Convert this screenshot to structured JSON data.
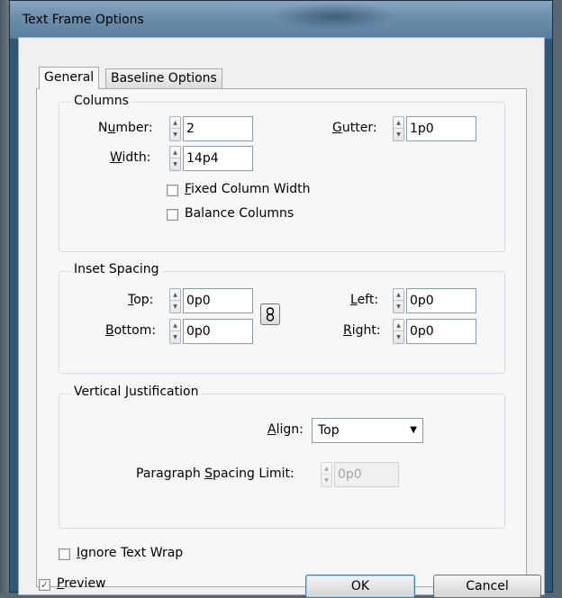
{
  "window": {
    "title": "Text Frame Options"
  },
  "tabs": [
    {
      "label": "General",
      "active": true
    },
    {
      "label": "Baseline Options",
      "active": false
    }
  ],
  "columns": {
    "group_label": "Columns",
    "number": {
      "label_pre": "N",
      "label_u": "u",
      "label_post": "mber:",
      "value": "2"
    },
    "gutter": {
      "label_pre": "",
      "label_u": "G",
      "label_post": "utter:",
      "value": "1p0"
    },
    "width": {
      "label_pre": "",
      "label_u": "W",
      "label_post": "idth:",
      "value": "14p4"
    },
    "fixed_column_width": {
      "label_pre": "",
      "label_u": "F",
      "label_post": "ixed Column Width",
      "checked": false
    },
    "balance_columns": {
      "label": "Balance Columns",
      "checked": false
    }
  },
  "inset_spacing": {
    "group_label": "Inset Spacing",
    "top": {
      "label_pre": "",
      "label_u": "T",
      "label_post": "op:",
      "value": "0p0"
    },
    "bottom": {
      "label_pre": "",
      "label_u": "B",
      "label_post": "ottom:",
      "value": "0p0"
    },
    "left": {
      "label_pre": "",
      "label_u": "L",
      "label_post": "eft:",
      "value": "0p0"
    },
    "right": {
      "label_pre": "",
      "label_u": "R",
      "label_post": "ight:",
      "value": "0p0"
    }
  },
  "vertical_justification": {
    "group_label": "Vertical Justification",
    "align": {
      "label_pre": "",
      "label_u": "A",
      "label_post": "lign:",
      "value": "Top"
    },
    "paragraph_spacing_limit": {
      "label_pre": "Paragraph ",
      "label_u": "S",
      "label_post": "pacing Limit:",
      "value": "0p0",
      "disabled": true
    }
  },
  "ignore_text_wrap": {
    "label_pre": "",
    "label_u": "I",
    "label_post": "gnore Text Wrap",
    "checked": false
  },
  "preview": {
    "label_pre": "",
    "label_u": "P",
    "label_post": "review",
    "checked": true
  },
  "buttons": {
    "ok": "OK",
    "cancel": "Cancel"
  },
  "icons": {
    "spinner_up": "▲",
    "spinner_down": "▼",
    "dropdown": "▼",
    "check": "✓",
    "link": "chain-link-icon"
  },
  "colors": {
    "titlebar": "#6d90ad",
    "accent": "#3c7fb1"
  }
}
